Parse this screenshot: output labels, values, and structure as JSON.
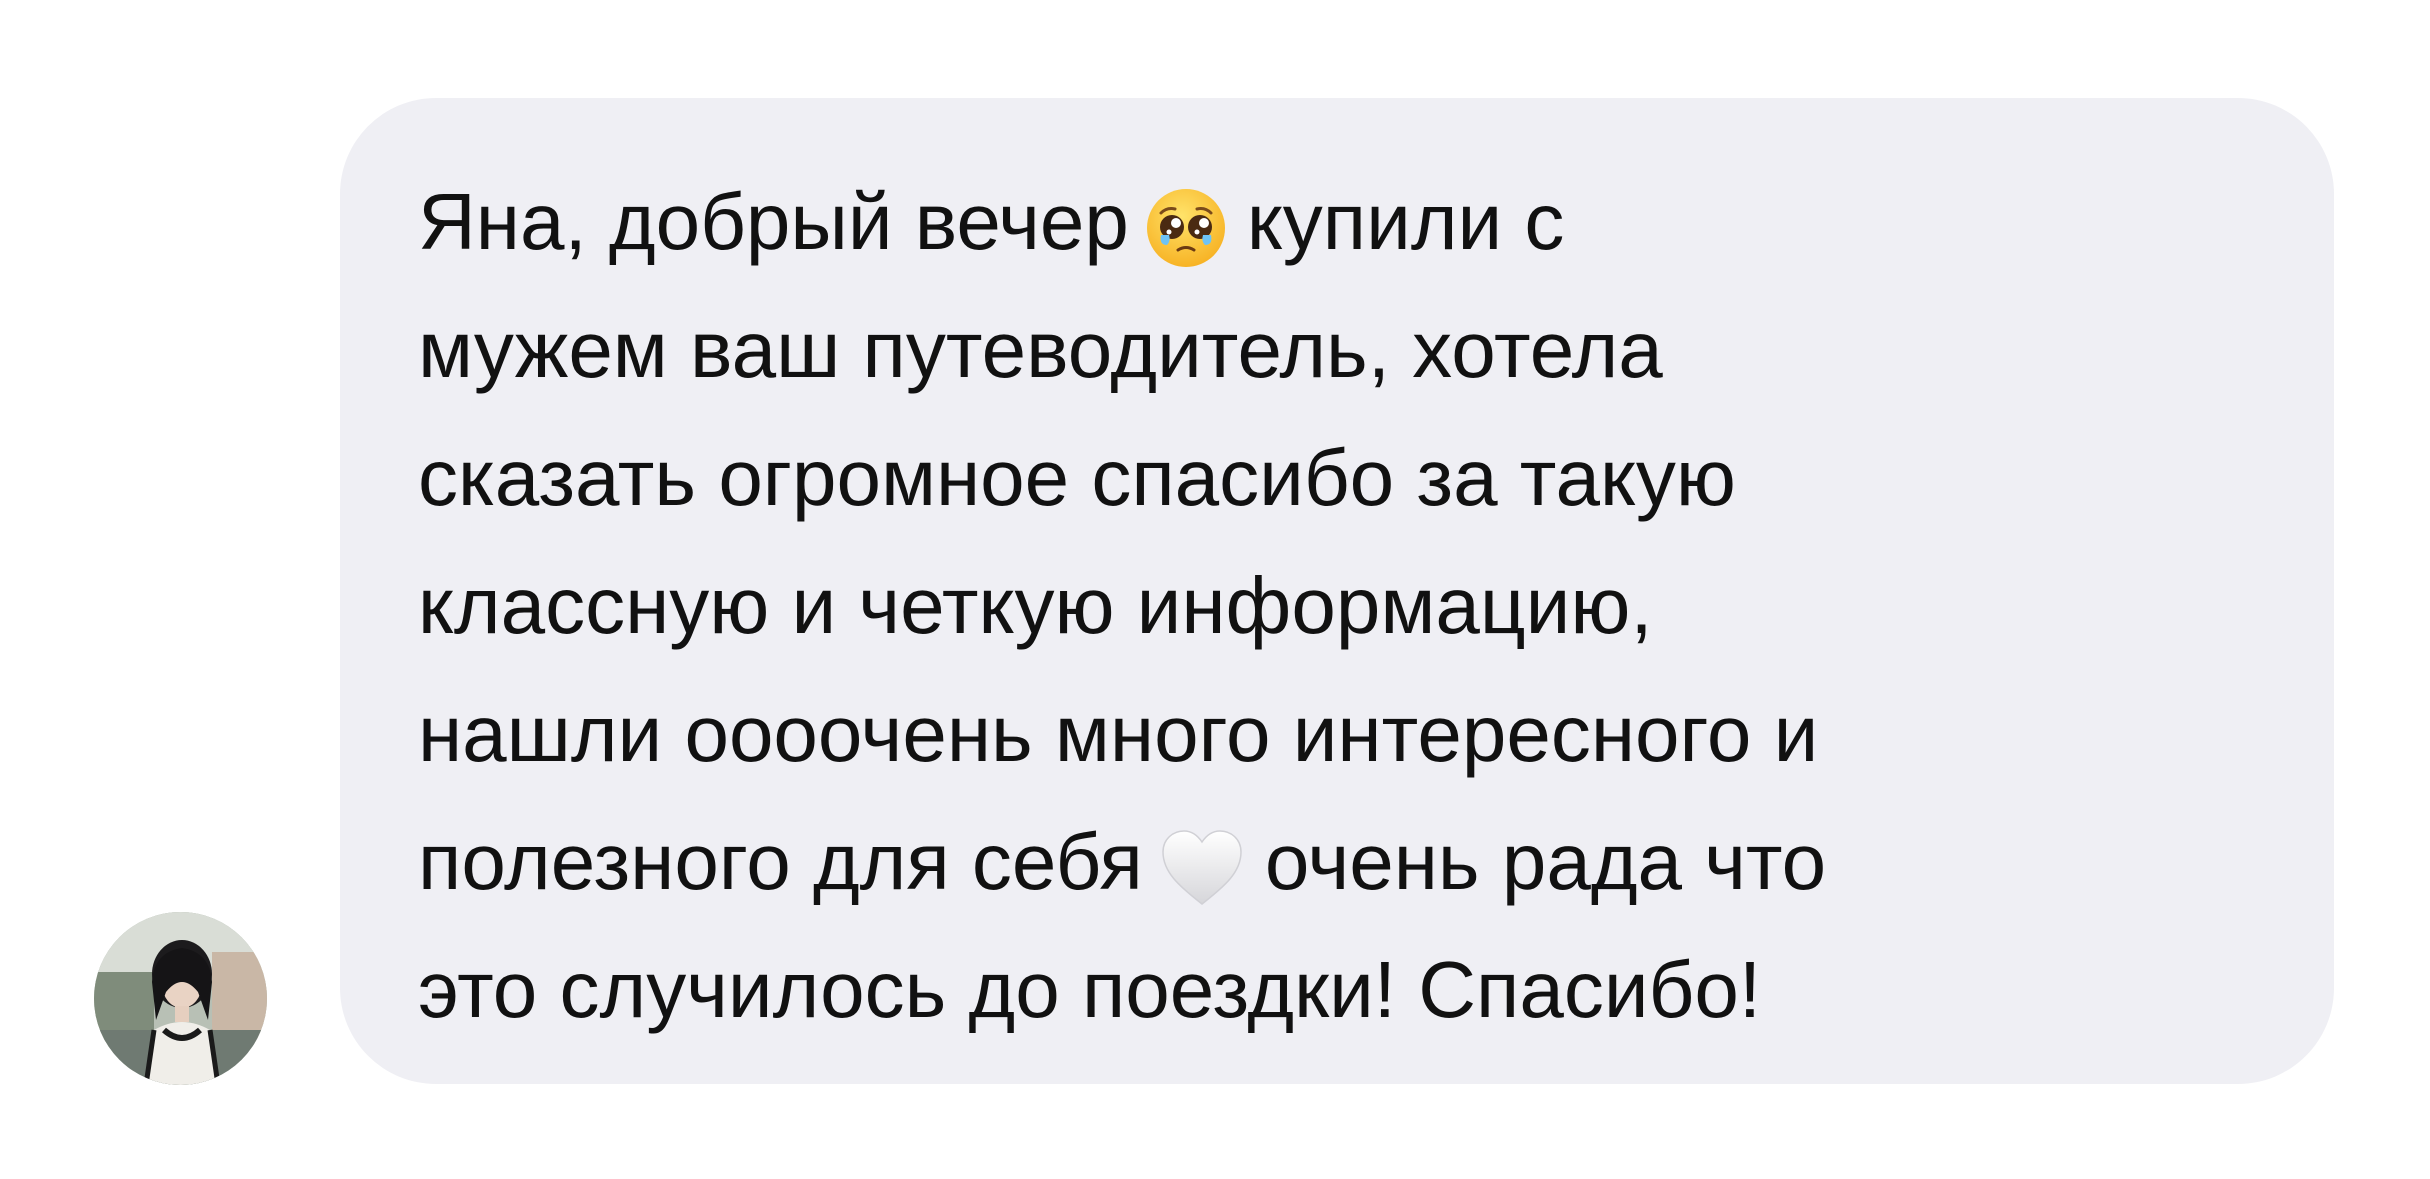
{
  "message": {
    "lines": [
      {
        "text": "Яна, добрый вечер",
        "emoji_after": "pleading-face-icon",
        "text_after": "купили с"
      },
      {
        "text": "мужем ваш путеводитель, хотела"
      },
      {
        "text": "сказать огромное спасибо за такую"
      },
      {
        "text": "классную и четкую информацию,"
      },
      {
        "text": "нашли оооочень много интересного и"
      },
      {
        "text": "полезного для себя",
        "emoji_after": "white-heart-icon",
        "text_after": "очень рада что"
      },
      {
        "text": "это случилось до поездки! Спасибо!"
      }
    ],
    "bubble_color": "#efeff4",
    "text_color": "#111111"
  },
  "sender": {
    "avatar_icon": "user-avatar-photo"
  }
}
